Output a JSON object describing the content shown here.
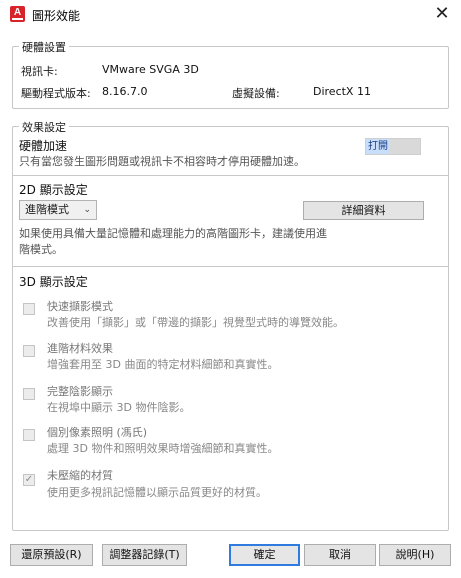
{
  "window": {
    "title": "圖形效能",
    "app_icon_letter": "A",
    "close_glyph": "✕"
  },
  "hardware": {
    "legend": "硬體設置",
    "video_card_label": "視訊卡:",
    "video_card_value": "VMware SVGA 3D",
    "driver_label": "驅動程式版本:",
    "driver_value": "8.16.7.0",
    "virtual_device_label": "虛擬設備:",
    "virtual_device_value": "DirectX 11"
  },
  "effects": {
    "legend": "效果設定",
    "hw_accel": {
      "title": "硬體加速",
      "description": "只有當您發生圖形問題或視訊卡不相容時才停用硬體加速。",
      "toggle_label": "打開"
    },
    "display_2d": {
      "title": "2D 顯示設定",
      "dropdown_value": "進階模式",
      "dropdown_chevron": "⌄",
      "details_button": "詳細資料",
      "description_line1": "如果使用具備大量記憶體和處理能力的高階圖形卡，建議使用進",
      "description_line2": "階模式。"
    },
    "display_3d": {
      "title": "3D 顯示設定",
      "options": [
        {
          "title": "快速擷影模式",
          "description": "改善使用「擷影」或「帶邊的擷影」視覺型式時的導覽效能。",
          "checked": false
        },
        {
          "title": "進階材料效果",
          "description": "增強套用至 3D 曲面的特定材料細節和真實性。",
          "checked": false
        },
        {
          "title": "完整陰影顯示",
          "description": "在視埠中顯示 3D 物件陰影。",
          "checked": false
        },
        {
          "title": "個別像素照明 (馮氏)",
          "description": "處理 3D 物件和照明效果時增強細節和真實性。",
          "checked": false
        },
        {
          "title": "未壓縮的材質",
          "description": "使用更多視訊記憶體以顯示品質更好的材質。",
          "checked": true
        }
      ],
      "check_glyph": "✓"
    }
  },
  "footer": {
    "restore_defaults": "還原預設(R)",
    "tuner_log": "調整器記錄(T)",
    "ok": "確定",
    "cancel": "取消",
    "help": "說明(H)"
  },
  "colors": {
    "toggle_on_bg": "#c9defa",
    "primary_button_border": "#2f7be0",
    "app_icon": "#d8232a"
  }
}
